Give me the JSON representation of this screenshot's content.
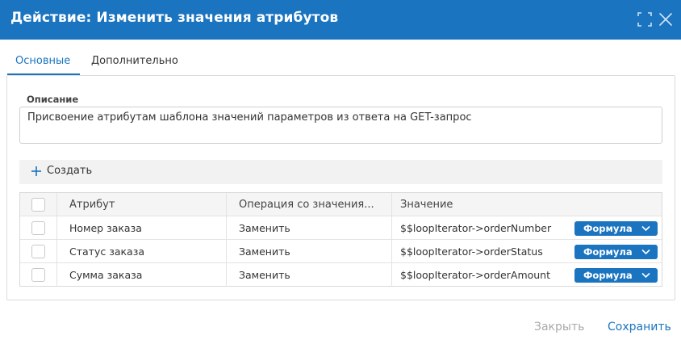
{
  "dialog": {
    "title": "Действие: Изменить значения атрибутов",
    "maximize_icon": "maximize-icon",
    "close_icon": "close-icon"
  },
  "tabs": [
    {
      "label": "Основные",
      "active": true
    },
    {
      "label": "Дополнительно",
      "active": false
    }
  ],
  "description": {
    "label": "Описание",
    "value": "Присвоение атрибутам шаблона значений параметров из ответа на GET-запрос"
  },
  "toolbar": {
    "create_label": "Создать",
    "create_icon": "plus-icon"
  },
  "table": {
    "columns": [
      "Атрибут",
      "Операция со значения...",
      "Значение"
    ],
    "rows": [
      {
        "attribute": "Номер заказа",
        "operation": "Заменить",
        "value": "$$loopIterator->orderNumber",
        "type": "Формула"
      },
      {
        "attribute": "Статус заказа",
        "operation": "Заменить",
        "value": "$$loopIterator->orderStatus",
        "type": "Формула"
      },
      {
        "attribute": "Сумма заказа",
        "operation": "Заменить",
        "value": "$$loopIterator->orderAmount",
        "type": "Формула"
      }
    ]
  },
  "footer": {
    "close_label": "Закрыть",
    "save_label": "Сохранить"
  },
  "colors": {
    "accent": "#1a74c0",
    "disabled_text": "#a9a9a9"
  }
}
